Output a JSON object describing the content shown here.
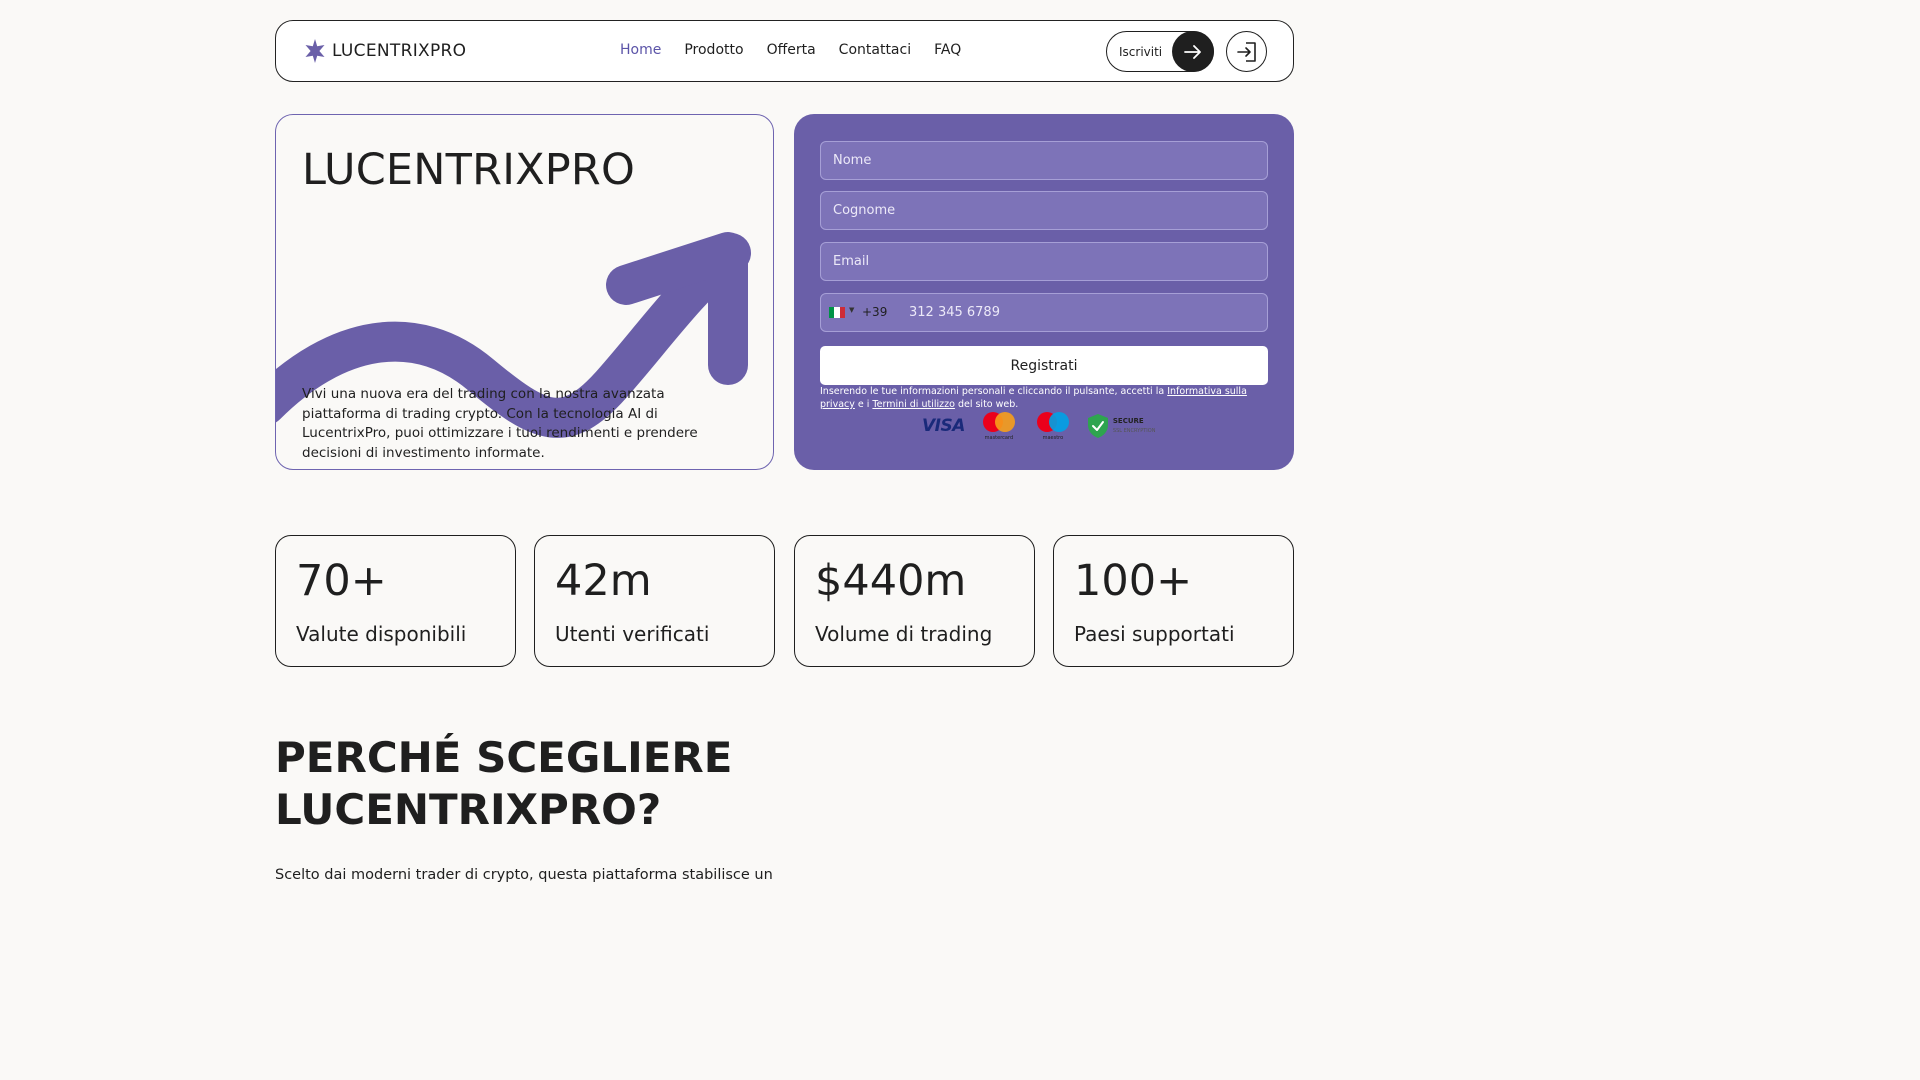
{
  "brand": {
    "name": "LUCENTRIXPRO",
    "accent": "#6a5fa8"
  },
  "nav": {
    "links": [
      "Home",
      "Prodotto",
      "Offerta",
      "Contattaci",
      "FAQ"
    ],
    "active": "Home",
    "signup_label": "Iscriviti"
  },
  "hero": {
    "title": "LUCENTRIXPRO",
    "description": "Vivi una nuova era del trading con la nostra avanzata piattaforma di trading crypto. Con la tecnologia AI di LucentrixPro, puoi ottimizzare i tuoi rendimenti e prendere decisioni di investimento informate."
  },
  "form": {
    "first_name_placeholder": "Nome",
    "last_name_placeholder": "Cognome",
    "email_placeholder": "Email",
    "dial_code": "+39",
    "phone_placeholder": "312 345 6789",
    "submit_label": "Registrati",
    "consent_prefix": "Inserendo le tue informazioni personali e cliccando il pulsante, accetti la ",
    "privacy_link": "Informativa sulla privacy",
    "consent_mid": " e i ",
    "terms_link": "Termini di utilizzo",
    "consent_suffix": " del sito web.",
    "payments": {
      "visa": "VISA",
      "mastercard": "mastercard",
      "maestro": "maestro",
      "secure": "SECURE",
      "secure_sub": "SSL ENCRYPTION"
    }
  },
  "stats": [
    {
      "value": "70+",
      "label": "Valute disponibili"
    },
    {
      "value": "42m",
      "label": "Utenti verificati"
    },
    {
      "value": "$440m",
      "label": "Volume di trading"
    },
    {
      "value": "100+",
      "label": "Paesi supportati"
    }
  ],
  "why": {
    "title": "PERCHÉ SCEGLIERE LUCENTRIXPRO?",
    "text": "Scelto dai moderni trader di crypto, questa piattaforma stabilisce un"
  }
}
